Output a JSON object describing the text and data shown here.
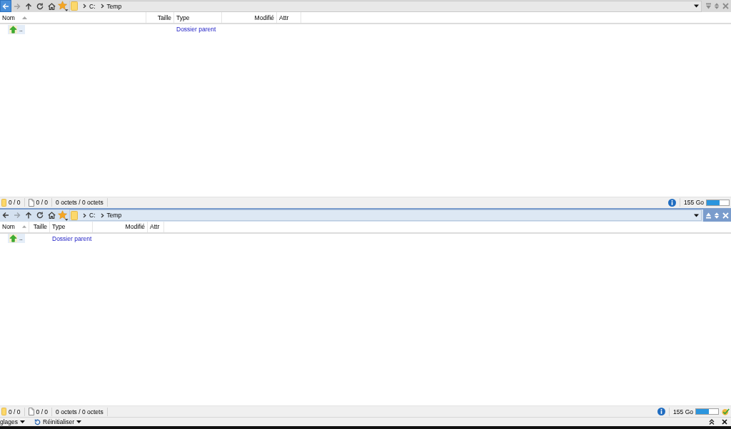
{
  "panes": [
    {
      "active": false,
      "toolbar": {
        "buttons": [
          {
            "kind": "back",
            "disabled": false,
            "hovered": true
          },
          {
            "kind": "forward",
            "disabled": true,
            "hovered": false
          },
          {
            "kind": "up",
            "disabled": false,
            "hovered": false
          },
          {
            "kind": "refresh",
            "disabled": false,
            "hovered": false
          },
          {
            "kind": "home",
            "disabled": false,
            "hovered": false
          },
          {
            "kind": "favorites",
            "disabled": false,
            "hovered": false
          }
        ],
        "path": [
          "C:",
          "Temp"
        ],
        "pane_buttons": [
          {
            "kind": "move-down"
          },
          {
            "kind": "swap"
          },
          {
            "kind": "close"
          }
        ]
      },
      "columns": [
        {
          "label": "Nom",
          "sorted": true
        },
        {
          "label": "Taille",
          "sorted": false
        },
        {
          "label": "Type",
          "sorted": false
        },
        {
          "label": "Modifié",
          "sorted": false
        },
        {
          "label": "Attr",
          "sorted": false
        }
      ],
      "rows": [
        {
          "name": "..",
          "type": "Dossier parent",
          "focused": true
        }
      ],
      "status": {
        "folders": "0 / 0",
        "files": "0 / 0",
        "size": "0 octets / 0 octets",
        "free_space": "155 Go",
        "disk_usage": {
          "level": 0.58
        }
      }
    },
    {
      "active": true,
      "toolbar": {
        "buttons": [
          {
            "kind": "back",
            "disabled": false,
            "hovered": false
          },
          {
            "kind": "forward",
            "disabled": true,
            "hovered": false
          },
          {
            "kind": "up",
            "disabled": false,
            "hovered": false
          },
          {
            "kind": "refresh",
            "disabled": false,
            "hovered": false
          },
          {
            "kind": "home",
            "disabled": false,
            "hovered": false
          },
          {
            "kind": "favorites",
            "disabled": false,
            "hovered": false
          }
        ],
        "path": [
          "C:",
          "Temp"
        ],
        "pane_buttons": [
          {
            "kind": "move-up"
          },
          {
            "kind": "swap"
          },
          {
            "kind": "close"
          }
        ]
      },
      "columns": [
        {
          "label": "Nom",
          "sorted": true
        },
        {
          "label": "Taille",
          "sorted": false
        },
        {
          "label": "Type",
          "sorted": false
        },
        {
          "label": "Modifié",
          "sorted": false
        },
        {
          "label": "Attr",
          "sorted": false
        }
      ],
      "rows": [
        {
          "name": "..",
          "type": "Dossier parent",
          "focused": true
        }
      ],
      "status": {
        "folders": "0 / 0",
        "files": "0 / 0",
        "size": "0 octets / 0 octets",
        "free_space": "155 Go",
        "disk_usage": {
          "level": 0.58
        }
      }
    }
  ],
  "bottom_bar": {
    "buttons": [
      {
        "kind": "menu",
        "label": "glages"
      },
      {
        "kind": "reset",
        "label": "Réinitialiser"
      }
    ],
    "actions": [
      {
        "kind": "expand"
      },
      {
        "kind": "close"
      }
    ]
  }
}
